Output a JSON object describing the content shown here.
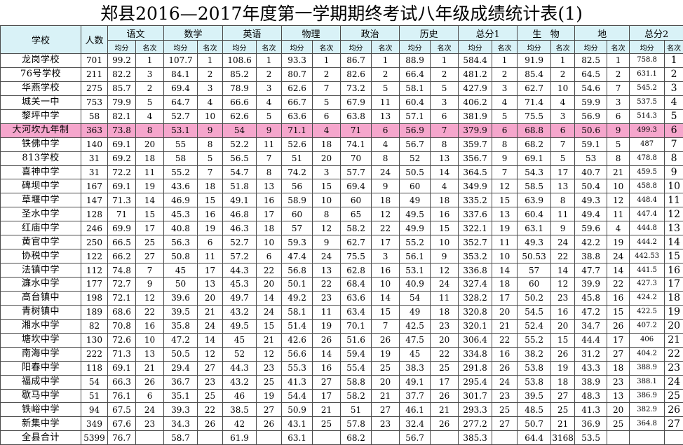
{
  "title": "郑县2016—2017年度第一学期期终考试八年级成绩统计表(1)",
  "headers": {
    "school": "学校",
    "count": "人数",
    "subjects": [
      "语文",
      "数学",
      "英语",
      "物理",
      "政治",
      "历史",
      "总分1",
      "生   物",
      "地",
      "总分2"
    ],
    "avg": "均分",
    "rank": "名次"
  },
  "rows": [
    {
      "name": "龙岗学校",
      "n": "701",
      "v": [
        "99.2",
        "1",
        "107.7",
        "1",
        "108.6",
        "1",
        "93.3",
        "1",
        "86.7",
        "1",
        "88.9",
        "1",
        "584.4",
        "1",
        "91.9",
        "1",
        "82.5",
        "1",
        "758.8",
        "1"
      ]
    },
    {
      "name": "76号学校",
      "n": "211",
      "v": [
        "82.2",
        "3",
        "84.1",
        "2",
        "85.2",
        "2",
        "80.7",
        "2",
        "82.6",
        "2",
        "66.4",
        "2",
        "481.2",
        "2",
        "85.4",
        "2",
        "64.5",
        "2",
        "631.1",
        "2"
      ]
    },
    {
      "name": "华燕学校",
      "n": "275",
      "v": [
        "85.7",
        "2",
        "69.4",
        "3",
        "78.9",
        "3",
        "62.6",
        "7",
        "73.2",
        "5",
        "58.1",
        "5",
        "427.9",
        "3",
        "62.7",
        "10",
        "54.6",
        "7",
        "545.2",
        "3"
      ]
    },
    {
      "name": "城关一中",
      "n": "753",
      "v": [
        "79.9",
        "5",
        "64.7",
        "4",
        "66.6",
        "4",
        "66.7",
        "5",
        "67.9",
        "11",
        "60.4",
        "3",
        "406.2",
        "4",
        "71.4",
        "4",
        "59.9",
        "3",
        "537.5",
        "4"
      ]
    },
    {
      "name": "黎坪中学",
      "n": "58",
      "v": [
        "82.1",
        "4",
        "52.7",
        "10",
        "62.6",
        "5",
        "63.6",
        "6",
        "63.8",
        "13",
        "57.1",
        "6",
        "381.9",
        "5",
        "75.5",
        "3",
        "56.9",
        "6",
        "514.3",
        "5"
      ]
    },
    {
      "name": "大河坎九年制",
      "n": "363",
      "v": [
        "73.8",
        "8",
        "53.1",
        "9",
        "54",
        "9",
        "71.1",
        "4",
        "71",
        "6",
        "56.9",
        "7",
        "379.9",
        "6",
        "68.8",
        "6",
        "50.6",
        "9",
        "499.3",
        "6"
      ],
      "hl": true
    },
    {
      "name": "铁佛中学",
      "n": "140",
      "v": [
        "69.1",
        "20",
        "55",
        "8",
        "52.2",
        "11",
        "52.6",
        "18",
        "74.1",
        "4",
        "56.7",
        "8",
        "359.7",
        "8",
        "68.2",
        "7",
        "59.1",
        "5",
        "487",
        "7"
      ]
    },
    {
      "name": "813学校",
      "n": "31",
      "v": [
        "69.2",
        "18",
        "58",
        "5",
        "56.5",
        "7",
        "51",
        "20",
        "70",
        "8",
        "52",
        "13",
        "356.7",
        "9",
        "69.1",
        "5",
        "53",
        "8",
        "478.8",
        "8"
      ]
    },
    {
      "name": "喜神中学",
      "n": "31",
      "v": [
        "72.2",
        "11",
        "55.2",
        "7",
        "54.7",
        "8",
        "74.2",
        "3",
        "57.7",
        "24",
        "50.5",
        "14",
        "364.5",
        "7",
        "54.3",
        "17",
        "40.7",
        "21",
        "459.5",
        "9"
      ]
    },
    {
      "name": "碑坝中学",
      "n": "167",
      "v": [
        "69.1",
        "19",
        "43.6",
        "18",
        "51.8",
        "13",
        "56",
        "15",
        "69.4",
        "9",
        "60",
        "4",
        "349.9",
        "12",
        "58.5",
        "13",
        "50.4",
        "10",
        "458.8",
        "10"
      ]
    },
    {
      "name": "草堰中学",
      "n": "147",
      "v": [
        "71.3",
        "14",
        "46.9",
        "15",
        "49.1",
        "16",
        "58.9",
        "10",
        "60",
        "18",
        "49",
        "18",
        "335.2",
        "15",
        "63.9",
        "8",
        "49.3",
        "12",
        "448.4",
        "11"
      ]
    },
    {
      "name": "圣水中学",
      "n": "128",
      "v": [
        "71",
        "15",
        "45.3",
        "16",
        "46.8",
        "17",
        "60",
        "8",
        "65",
        "12",
        "49.5",
        "16",
        "337.6",
        "13",
        "60.4",
        "11",
        "49.4",
        "11",
        "447.4",
        "12"
      ]
    },
    {
      "name": "红庙中学",
      "n": "246",
      "v": [
        "69.9",
        "17",
        "40.8",
        "19",
        "46.3",
        "18",
        "57",
        "12",
        "58.2",
        "22",
        "49.9",
        "15",
        "322.1",
        "19",
        "63.1",
        "9",
        "59.6",
        "4",
        "444.8",
        "13"
      ]
    },
    {
      "name": "黄官中学",
      "n": "250",
      "v": [
        "66.5",
        "25",
        "56.3",
        "6",
        "52.7",
        "10",
        "59.3",
        "9",
        "62.7",
        "17",
        "55.2",
        "10",
        "352.7",
        "11",
        "49.3",
        "24",
        "42.2",
        "19",
        "444.2",
        "14"
      ]
    },
    {
      "name": "协税中学",
      "n": "122",
      "v": [
        "66.2",
        "27",
        "50.8",
        "11",
        "57.2",
        "6",
        "47.4",
        "24",
        "75.5",
        "3",
        "56.1",
        "9",
        "353.2",
        "10",
        "50.53",
        "22",
        "38.8",
        "24",
        "442.53",
        "15"
      ]
    },
    {
      "name": "法镇中学",
      "n": "112",
      "v": [
        "74.8",
        "7",
        "45",
        "17",
        "44.3",
        "22",
        "56.8",
        "13",
        "62.8",
        "16",
        "53.1",
        "12",
        "336.8",
        "14",
        "57",
        "14",
        "47.7",
        "14",
        "441.5",
        "16"
      ]
    },
    {
      "name": "濂水中学",
      "n": "177",
      "v": [
        "72.7",
        "9",
        "50",
        "13",
        "45.3",
        "20",
        "50.1",
        "22",
        "68.4",
        "10",
        "40.9",
        "24",
        "327.4",
        "18",
        "60",
        "12",
        "39.9",
        "22",
        "427.3",
        "17"
      ]
    },
    {
      "name": "高台镇中",
      "n": "198",
      "v": [
        "72.1",
        "12",
        "39.6",
        "20",
        "49.7",
        "14",
        "49.2",
        "23",
        "63.6",
        "14",
        "54",
        "11",
        "328.2",
        "17",
        "50.2",
        "23",
        "45.8",
        "16",
        "424.2",
        "18"
      ]
    },
    {
      "name": "青树镇中",
      "n": "189",
      "v": [
        "68.6",
        "22",
        "39.5",
        "21",
        "43.2",
        "24",
        "58.1",
        "11",
        "63.4",
        "15",
        "49",
        "18",
        "320.8",
        "20",
        "54.5",
        "16",
        "47.2",
        "15",
        "422.5",
        "19"
      ]
    },
    {
      "name": "湘水中学",
      "n": "82",
      "v": [
        "70.8",
        "16",
        "35.8",
        "24",
        "49.5",
        "15",
        "51.4",
        "19",
        "70.1",
        "7",
        "42.5",
        "23",
        "320.1",
        "21",
        "52.4",
        "20",
        "34.7",
        "26",
        "407.2",
        "20"
      ]
    },
    {
      "name": "塘坎中学",
      "n": "130",
      "v": [
        "72.6",
        "10",
        "47.2",
        "14",
        "45",
        "21",
        "42.6",
        "26",
        "51.6",
        "26",
        "47.5",
        "20",
        "306.4",
        "22",
        "55.2",
        "15",
        "44.4",
        "17",
        "406",
        "21"
      ]
    },
    {
      "name": "南海中学",
      "n": "222",
      "v": [
        "71.3",
        "13",
        "50.5",
        "12",
        "52",
        "12",
        "56.6",
        "14",
        "59.4",
        "19",
        "45",
        "22",
        "334.8",
        "16",
        "38.2",
        "26",
        "31.2",
        "27",
        "404.2",
        "22"
      ]
    },
    {
      "name": "阳春中学",
      "n": "118",
      "v": [
        "69.1",
        "21",
        "29.4",
        "27",
        "44.3",
        "23",
        "55.3",
        "16",
        "55.4",
        "25",
        "38.3",
        "25",
        "291.8",
        "26",
        "53.8",
        "19",
        "43.3",
        "18",
        "388.9",
        "23"
      ]
    },
    {
      "name": "福成中学",
      "n": "54",
      "v": [
        "66.3",
        "26",
        "36.7",
        "23",
        "43.2",
        "25",
        "41.3",
        "27",
        "58.8",
        "20",
        "49.1",
        "17",
        "295.4",
        "24",
        "53.8",
        "18",
        "38.9",
        "23",
        "388.1",
        "24"
      ]
    },
    {
      "name": "歇马中学",
      "n": "51",
      "v": [
        "76.1",
        "6",
        "35.1",
        "25",
        "46",
        "19",
        "54.4",
        "17",
        "58.2",
        "21",
        "37.7",
        "26",
        "301.7",
        "23",
        "39.5",
        "27",
        "48.3",
        "13",
        "386.9",
        "25"
      ]
    },
    {
      "name": "铁峪中学",
      "n": "94",
      "v": [
        "67.5",
        "24",
        "39.3",
        "22",
        "38.5",
        "27",
        "50.9",
        "21",
        "51",
        "27",
        "46.1",
        "21",
        "293.3",
        "25",
        "48.5",
        "25",
        "41.3",
        "20",
        "382.9",
        "26"
      ]
    },
    {
      "name": "新集中学",
      "n": "349",
      "v": [
        "67.6",
        "23",
        "34.3",
        "26",
        "42",
        "26",
        "43.1",
        "25",
        "57.8",
        "23",
        "32.4",
        "26",
        "277.2",
        "27",
        "50.7",
        "21",
        "36.9",
        "25",
        "364.8",
        "27"
      ]
    },
    {
      "name": "全县合计",
      "n": "5399",
      "v": [
        "76.7",
        "",
        "58.7",
        "",
        "61.9",
        "",
        "63.1",
        "",
        "68.2",
        "",
        "56.7",
        "",
        "385.3",
        "",
        "64.4",
        "3168",
        "53.5",
        "",
        "",
        ""
      ]
    }
  ]
}
